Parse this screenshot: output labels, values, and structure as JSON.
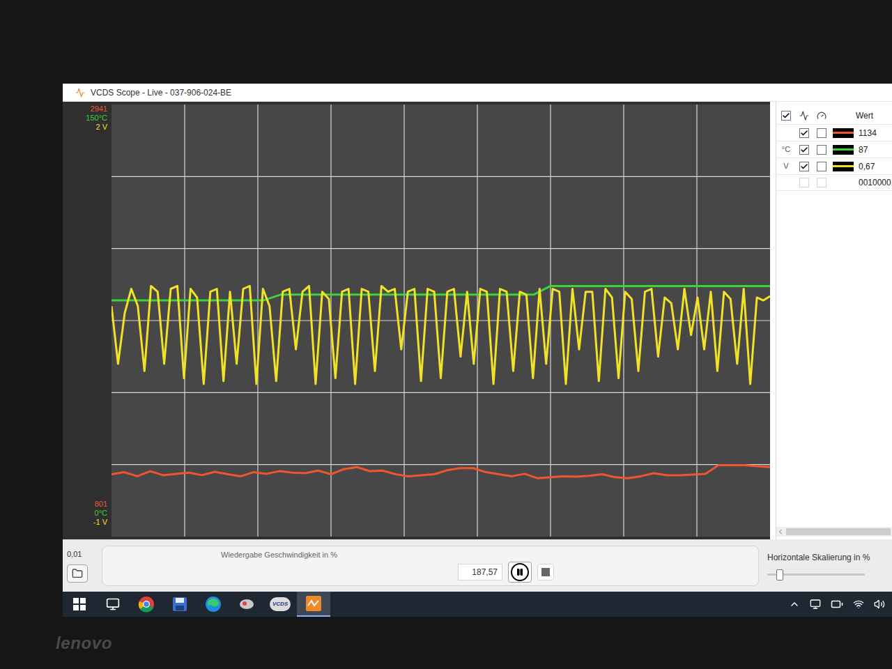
{
  "window": {
    "title": "VCDS Scope - Live - 037-906-024-BE"
  },
  "chart": {
    "series": [
      {
        "color": "#f0552d",
        "unit": "",
        "visible": true,
        "gauge": false,
        "value": "1134",
        "top": "2941",
        "bottom": "801",
        "values": [
          1110,
          1120,
          1100,
          1125,
          1105,
          1112,
          1118,
          1105,
          1122,
          1110,
          1100,
          1120,
          1112,
          1125,
          1118,
          1115,
          1128,
          1110,
          1135,
          1145,
          1125,
          1128,
          1110,
          1100,
          1105,
          1110,
          1130,
          1140,
          1140,
          1120,
          1110,
          1100,
          1112,
          1090,
          1095,
          1100,
          1098,
          1102,
          1110,
          1095,
          1090,
          1100,
          1115,
          1105,
          1105,
          1108,
          1112,
          1155,
          1155,
          1155,
          1150,
          1145
        ]
      },
      {
        "color": "#3ad43a",
        "unit": "°C",
        "visible": true,
        "gauge": false,
        "value": "87",
        "top": "150°C",
        "bottom": "0°C",
        "values": [
          82,
          82,
          82,
          82,
          82,
          82,
          82,
          82,
          82,
          82,
          84,
          84,
          84,
          84,
          84,
          84,
          84,
          84,
          84,
          84,
          84,
          84,
          84,
          84,
          84,
          84,
          87,
          87,
          87,
          87,
          87,
          87,
          87,
          87,
          87,
          87,
          87,
          87,
          87,
          87
        ]
      },
      {
        "color": "#f2e227",
        "unit": "V",
        "visible": true,
        "gauge": false,
        "value": "0,67",
        "top": "2 V",
        "bottom": "-1 V",
        "values": [
          0.6,
          0.2,
          0.55,
          0.72,
          0.6,
          0.15,
          0.74,
          0.7,
          0.2,
          0.72,
          0.74,
          0.1,
          0.72,
          0.66,
          0.06,
          0.7,
          0.72,
          0.08,
          0.7,
          0.2,
          0.72,
          0.74,
          0.06,
          0.72,
          0.6,
          0.08,
          0.7,
          0.72,
          0.3,
          0.7,
          0.74,
          0.06,
          0.7,
          0.65,
          0.1,
          0.7,
          0.72,
          0.06,
          0.72,
          0.7,
          0.15,
          0.74,
          0.7,
          0.72,
          0.3,
          0.7,
          0.72,
          0.08,
          0.72,
          0.7,
          0.1,
          0.7,
          0.72,
          0.25,
          0.7,
          0.2,
          0.72,
          0.7,
          0.06,
          0.72,
          0.7,
          0.15,
          0.7,
          0.68,
          0.1,
          0.72,
          0.2,
          0.72,
          0.7,
          0.06,
          0.72,
          0.3,
          0.7,
          0.7,
          0.08,
          0.72,
          0.66,
          0.1,
          0.7,
          0.65,
          0.15,
          0.7,
          0.72,
          0.25,
          0.66,
          0.62,
          0.3,
          0.72,
          0.4,
          0.66,
          0.3,
          0.7,
          0.15,
          0.7,
          0.65,
          0.2,
          0.72,
          0.06,
          0.66,
          0.64,
          0.67
        ]
      }
    ],
    "extra_row": {
      "unit": "",
      "visible": false,
      "gauge": false,
      "value": "0010000"
    }
  },
  "panel": {
    "all_checked": true,
    "value_header": "Wert"
  },
  "controls": {
    "min_label": "0,01",
    "speed_label": "Wiedergabe Geschwindigkeit in %",
    "speed_value": "187,57",
    "scale_label": "Horizontale Skalierung in %",
    "scale_level": 0.1
  },
  "taskbar": {
    "items": [
      {
        "kind": "start",
        "label": "",
        "selected": false
      },
      {
        "kind": "taskview",
        "label": "",
        "selected": false
      },
      {
        "kind": "chrome",
        "label": "",
        "selected": false
      },
      {
        "kind": "save",
        "label": "",
        "selected": false
      },
      {
        "kind": "edge",
        "label": "",
        "selected": false
      },
      {
        "kind": "tool",
        "label": "",
        "selected": false
      },
      {
        "kind": "vcds",
        "label": "VCDS",
        "selected": false
      },
      {
        "kind": "scope",
        "label": "",
        "selected": true
      }
    ]
  },
  "bezel": {
    "brand": "lenovo"
  }
}
